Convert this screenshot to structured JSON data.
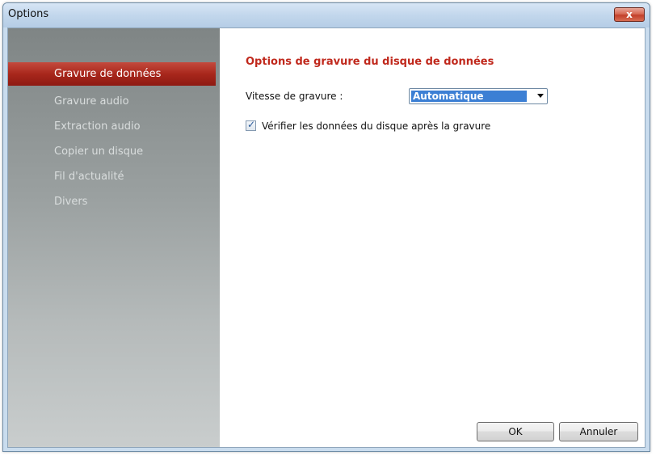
{
  "window": {
    "title": "Options",
    "close_label": "x"
  },
  "sidebar": {
    "items": [
      {
        "label": "Gravure de données",
        "active": true
      },
      {
        "label": "Gravure audio",
        "active": false
      },
      {
        "label": "Extraction audio",
        "active": false
      },
      {
        "label": "Copier un disque",
        "active": false
      },
      {
        "label": "Fil d'actualité",
        "active": false
      },
      {
        "label": "Divers",
        "active": false
      }
    ]
  },
  "main": {
    "section_title": "Options de gravure du disque de données",
    "speed_label": "Vitesse de gravure :",
    "speed_value": "Automatique",
    "verify_checked": true,
    "verify_label": "Vérifier les données du disque après la gravure"
  },
  "buttons": {
    "ok": "OK",
    "cancel": "Annuler"
  },
  "colors": {
    "active_nav": "#a8271c",
    "section_title": "#c0281c",
    "selection": "#3c7fd4"
  }
}
